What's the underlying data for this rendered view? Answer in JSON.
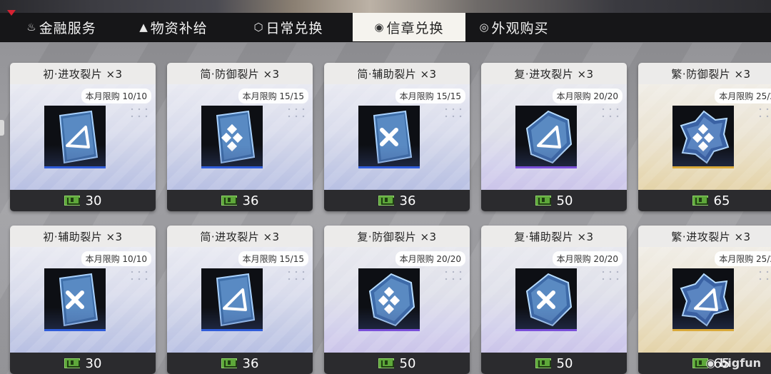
{
  "tabs": [
    {
      "label": "金融服务",
      "icon": "flame-icon",
      "glyph": "💧"
    },
    {
      "label": "物资补给",
      "icon": "supply-icon",
      "glyph": "▲"
    },
    {
      "label": "日常兑换",
      "icon": "cube-icon",
      "glyph": "⬡"
    },
    {
      "label": "信章兑换",
      "icon": "badge-icon",
      "glyph": "◉",
      "active": true
    },
    {
      "label": "外观购买",
      "icon": "palette-icon",
      "glyph": "◎"
    }
  ],
  "currency_icon": "badge-currency-icon",
  "limit_prefix": "本月限购",
  "cards": [
    {
      "title": "初·进攻裂片 ×3",
      "limit": "10/10",
      "price": "30",
      "tier": "a",
      "shape": "tilt",
      "glyph": "attack"
    },
    {
      "title": "简·防御裂片 ×3",
      "limit": "15/15",
      "price": "36",
      "tier": "a",
      "shape": "tilt",
      "glyph": "defense"
    },
    {
      "title": "简·辅助裂片 ×3",
      "limit": "15/15",
      "price": "36",
      "tier": "a",
      "shape": "tilt",
      "glyph": "support"
    },
    {
      "title": "复·进攻裂片 ×3",
      "limit": "20/20",
      "price": "50",
      "tier": "b",
      "shape": "hex",
      "glyph": "attack"
    },
    {
      "title": "繁·防御裂片 ×3",
      "limit": "25/2",
      "price": "65",
      "tier": "c",
      "shape": "star",
      "glyph": "defense"
    },
    {
      "title": "初·辅助裂片 ×3",
      "limit": "10/10",
      "price": "30",
      "tier": "a",
      "shape": "tilt",
      "glyph": "support"
    },
    {
      "title": "简·进攻裂片 ×3",
      "limit": "15/15",
      "price": "36",
      "tier": "a",
      "shape": "tilt",
      "glyph": "attack"
    },
    {
      "title": "复·防御裂片 ×3",
      "limit": "20/20",
      "price": "50",
      "tier": "b",
      "shape": "hex",
      "glyph": "defense"
    },
    {
      "title": "复·辅助裂片 ×3",
      "limit": "20/20",
      "price": "50",
      "tier": "b",
      "shape": "hex",
      "glyph": "support"
    },
    {
      "title": "繁·进攻裂片 ×3",
      "limit": "25/2",
      "price": "65",
      "tier": "c",
      "shape": "star",
      "glyph": "attack"
    }
  ],
  "watermark": "bigfun"
}
